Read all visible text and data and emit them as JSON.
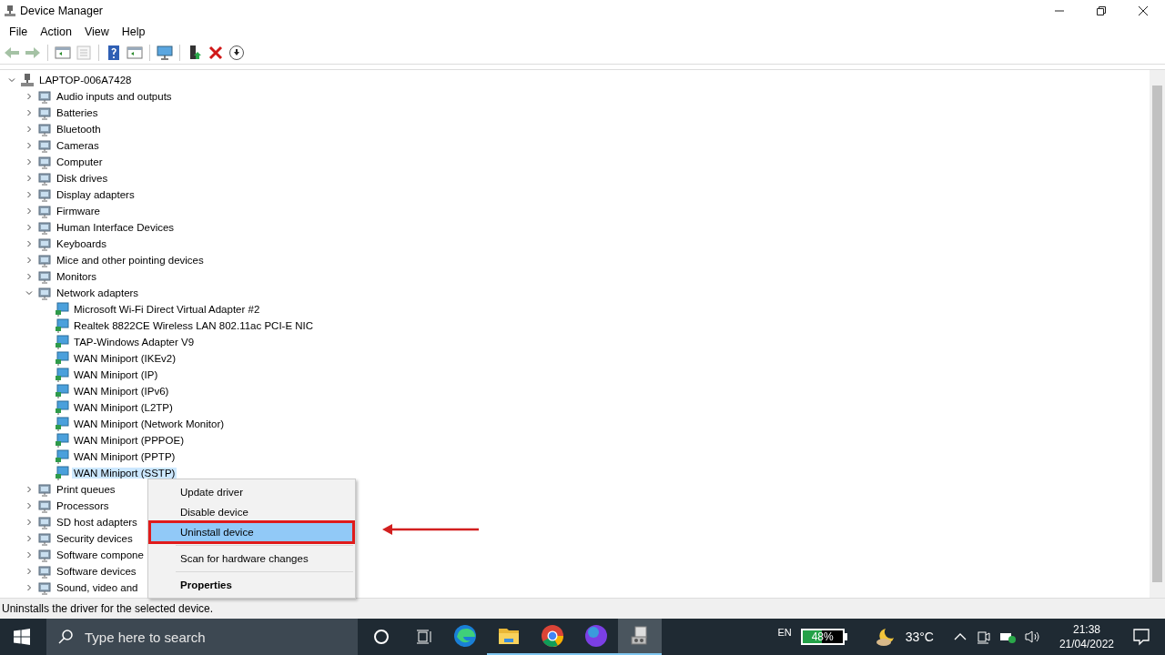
{
  "window": {
    "title": "Device Manager"
  },
  "menu": [
    "File",
    "Action",
    "View",
    "Help"
  ],
  "toolbar": [
    {
      "kind": "back",
      "disabled": true
    },
    {
      "kind": "forward",
      "disabled": true
    },
    {
      "kind": "pane",
      "disabled": false
    },
    {
      "kind": "list",
      "disabled": true
    },
    {
      "kind": "help",
      "disabled": false
    },
    {
      "kind": "pane",
      "disabled": false
    },
    {
      "kind": "monitor",
      "disabled": false
    },
    {
      "kind": "add",
      "disabled": false
    },
    {
      "kind": "remove",
      "disabled": false
    },
    {
      "kind": "download",
      "disabled": false
    }
  ],
  "tree": {
    "label": "LAPTOP-006A7428",
    "expanded": true,
    "selected": false,
    "children": [
      {
        "label": "Audio inputs and outputs",
        "expanded": false,
        "selected": false
      },
      {
        "label": "Batteries",
        "expanded": false,
        "selected": false
      },
      {
        "label": "Bluetooth",
        "expanded": false,
        "selected": false
      },
      {
        "label": "Cameras",
        "expanded": false,
        "selected": false
      },
      {
        "label": "Computer",
        "expanded": false,
        "selected": false
      },
      {
        "label": "Disk drives",
        "expanded": false,
        "selected": false
      },
      {
        "label": "Display adapters",
        "expanded": false,
        "selected": false
      },
      {
        "label": "Firmware",
        "expanded": false,
        "selected": false
      },
      {
        "label": "Human Interface Devices",
        "expanded": false,
        "selected": false
      },
      {
        "label": "Keyboards",
        "expanded": false,
        "selected": false
      },
      {
        "label": "Mice and other pointing devices",
        "expanded": false,
        "selected": false
      },
      {
        "label": "Monitors",
        "expanded": false,
        "selected": false
      },
      {
        "label": "Network adapters",
        "expanded": true,
        "selected": false,
        "children": [
          {
            "label": "Microsoft Wi-Fi Direct Virtual Adapter #2",
            "selected": false
          },
          {
            "label": "Realtek 8822CE Wireless LAN 802.11ac PCI-E NIC",
            "selected": false
          },
          {
            "label": "TAP-Windows Adapter V9",
            "selected": false
          },
          {
            "label": "WAN Miniport (IKEv2)",
            "selected": false
          },
          {
            "label": "WAN Miniport (IP)",
            "selected": false
          },
          {
            "label": "WAN Miniport (IPv6)",
            "selected": false
          },
          {
            "label": "WAN Miniport (L2TP)",
            "selected": false
          },
          {
            "label": "WAN Miniport (Network Monitor)",
            "selected": false
          },
          {
            "label": "WAN Miniport (PPPOE)",
            "selected": false
          },
          {
            "label": "WAN Miniport (PPTP)",
            "selected": false
          },
          {
            "label": "WAN Miniport (SSTP)",
            "selected": true
          }
        ]
      },
      {
        "label": "Print queues",
        "expanded": false,
        "selected": false
      },
      {
        "label": "Processors",
        "expanded": false,
        "selected": false
      },
      {
        "label": "SD host adapters",
        "expanded": false,
        "selected": false
      },
      {
        "label": "Security devices",
        "expanded": false,
        "selected": false
      },
      {
        "label": "Software compone",
        "expanded": false,
        "selected": false
      },
      {
        "label": "Software devices",
        "expanded": false,
        "selected": false
      },
      {
        "label": "Sound, video and",
        "expanded": false,
        "selected": false
      }
    ]
  },
  "context_menu": {
    "items": [
      {
        "kind": "item",
        "label": "Update driver",
        "selected": false,
        "bold": false,
        "marked": false
      },
      {
        "kind": "item",
        "label": "Disable device",
        "selected": false,
        "bold": false,
        "marked": false
      },
      {
        "kind": "item",
        "label": "Uninstall device",
        "selected": true,
        "bold": false,
        "marked": true
      },
      {
        "kind": "separator"
      },
      {
        "kind": "item",
        "label": "Scan for hardware changes",
        "selected": false,
        "bold": false,
        "marked": false
      },
      {
        "kind": "separator"
      },
      {
        "kind": "item",
        "label": "Properties",
        "selected": false,
        "bold": true,
        "marked": false
      }
    ]
  },
  "pointer_arrow": true,
  "status_bar": "Uninstalls the driver for the selected device.",
  "taskbar": {
    "search": {
      "placeholder": "Type here to search"
    },
    "apps": [
      {
        "kind": "edge",
        "open": false,
        "active": false
      },
      {
        "kind": "explorer",
        "open": true,
        "active": false
      },
      {
        "kind": "chrome",
        "open": true,
        "active": false
      },
      {
        "kind": "canva",
        "open": true,
        "active": false
      },
      {
        "kind": "devmgr",
        "open": true,
        "active": true
      }
    ],
    "language": "EN",
    "battery": {
      "reading": "48%",
      "level": 0.48
    },
    "weather": "33°C",
    "time": "21:38",
    "date": "21/04/2022"
  }
}
